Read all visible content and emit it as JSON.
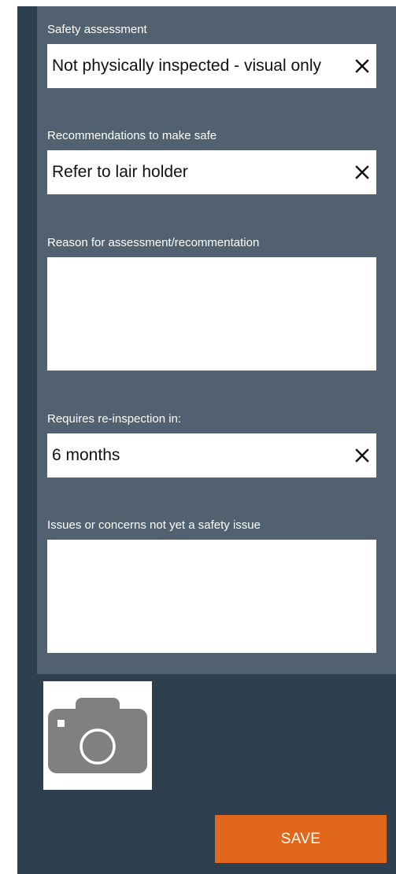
{
  "form": {
    "safety_assessment": {
      "label": "Safety assessment",
      "value": "Not physically inspected - visual only"
    },
    "recommendations": {
      "label": "Recommendations to make safe",
      "value": "Refer to lair holder"
    },
    "reason": {
      "label": "Reason for assessment/recommentation",
      "value": ""
    },
    "reinspection": {
      "label": "Requires re-inspection in:",
      "value": "6 months"
    },
    "issues": {
      "label": "Issues or concerns not yet a safety issue",
      "value": ""
    }
  },
  "icons": {
    "clear": "close-icon",
    "camera": "camera-icon"
  },
  "colors": {
    "app_background": "#2e3f50",
    "panel_background": "#526170",
    "accent": "#e0671b"
  },
  "actions": {
    "save_label": "SAVE"
  }
}
